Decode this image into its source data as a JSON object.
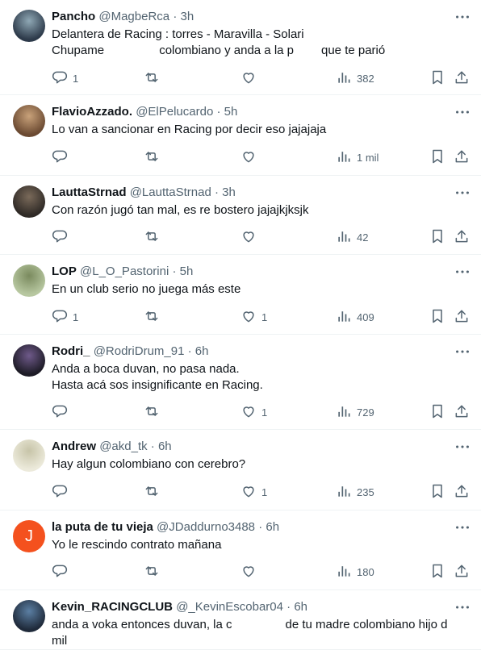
{
  "tweets": [
    {
      "name": "Pancho",
      "handle": "@MagbeRca",
      "separator": "·",
      "time": "3h",
      "avatar": {
        "kind": "photo",
        "colors": [
          "#2d3a4a",
          "#8fa8b5"
        ]
      },
      "lines": [
        [
          {
            "t": "Delantera de Racing : torres - Maravilla - Solari"
          }
        ],
        [
          {
            "t": "Chupame "
          },
          {
            "redact": true,
            "w": 64
          },
          {
            "t": "colombiano y anda a la p"
          },
          {
            "redact": true,
            "w": 34
          },
          {
            "t": "que te parió"
          }
        ]
      ],
      "stats": {
        "reply": "1",
        "retweet": "",
        "like": "",
        "views": "382"
      }
    },
    {
      "name": "FlavioAzzado.",
      "handle": "@ElPelucardo",
      "separator": "·",
      "time": "5h",
      "avatar": {
        "kind": "photo",
        "colors": [
          "#6b4a32",
          "#c9a27a"
        ]
      },
      "lines": [
        [
          {
            "t": "Lo van a sancionar en Racing por decir eso jajajaja"
          }
        ]
      ],
      "stats": {
        "reply": "",
        "retweet": "",
        "like": "",
        "views": "1 mil"
      }
    },
    {
      "name": "LauttaStrnad",
      "handle": "@LauttaStrnad",
      "separator": "·",
      "time": "3h",
      "avatar": {
        "kind": "photo",
        "colors": [
          "#2f2a26",
          "#7a6a5a"
        ]
      },
      "lines": [
        [
          {
            "t": "Con razón jugó tan mal, es re bostero jajajkjksjk"
          }
        ]
      ],
      "stats": {
        "reply": "",
        "retweet": "",
        "like": "",
        "views": "42"
      }
    },
    {
      "name": "LOP",
      "handle": "@L_O_Pastorini",
      "separator": "·",
      "time": "5h",
      "avatar": {
        "kind": "photo",
        "colors": [
          "#b7c7a0",
          "#7a8a5e"
        ]
      },
      "lines": [
        [
          {
            "t": "En un club serio no juega más este"
          }
        ]
      ],
      "stats": {
        "reply": "1",
        "retweet": "",
        "like": "1",
        "views": "409"
      }
    },
    {
      "name": "Rodri_",
      "handle": "@RodriDrum_91",
      "separator": "·",
      "time": "6h",
      "avatar": {
        "kind": "photo",
        "colors": [
          "#1d1b26",
          "#6f5a8a"
        ]
      },
      "lines": [
        [
          {
            "t": "Anda a boca duvan, no pasa nada."
          }
        ],
        [
          {
            "t": "Hasta acá sos insignificante en Racing."
          }
        ]
      ],
      "stats": {
        "reply": "",
        "retweet": "",
        "like": "1",
        "views": "729"
      }
    },
    {
      "name": "Andrew",
      "handle": "@akd_tk",
      "separator": "·",
      "time": "6h",
      "avatar": {
        "kind": "photo",
        "colors": [
          "#eceadb",
          "#c7c4a8"
        ]
      },
      "lines": [
        [
          {
            "t": "Hay algun colombiano con cerebro?"
          }
        ]
      ],
      "stats": {
        "reply": "",
        "retweet": "",
        "like": "1",
        "views": "235"
      }
    },
    {
      "name": "la puta de tu vieja",
      "handle": "@JDaddurno3488",
      "separator": "·",
      "time": "6h",
      "avatar": {
        "kind": "letter",
        "letter": "J",
        "colors": [
          "#f4511e",
          "#f4511e"
        ]
      },
      "lines": [
        [
          {
            "t": "Yo le rescindo contrato mañana"
          }
        ]
      ],
      "stats": {
        "reply": "",
        "retweet": "",
        "like": "",
        "views": "180"
      }
    },
    {
      "name": "Kevin_RACINGCLUB",
      "handle": "@_KevinEscobar04",
      "separator": "·",
      "time": "6h",
      "avatar": {
        "kind": "photo",
        "colors": [
          "#1f2a3a",
          "#5b7fa3"
        ]
      },
      "lines": [
        [
          {
            "t": "anda a voka entonces duvan, la c"
          },
          {
            "redact": true,
            "w": 66
          },
          {
            "t": "de tu madre colombiano hijo d"
          }
        ],
        [
          {
            "t": "mil"
          }
        ]
      ],
      "stats": {
        "reply": "",
        "retweet": "",
        "like": "",
        "views": ""
      }
    }
  ],
  "colors": {
    "text": "#0f1419",
    "muted": "#536471",
    "divider": "#eff3f4"
  }
}
